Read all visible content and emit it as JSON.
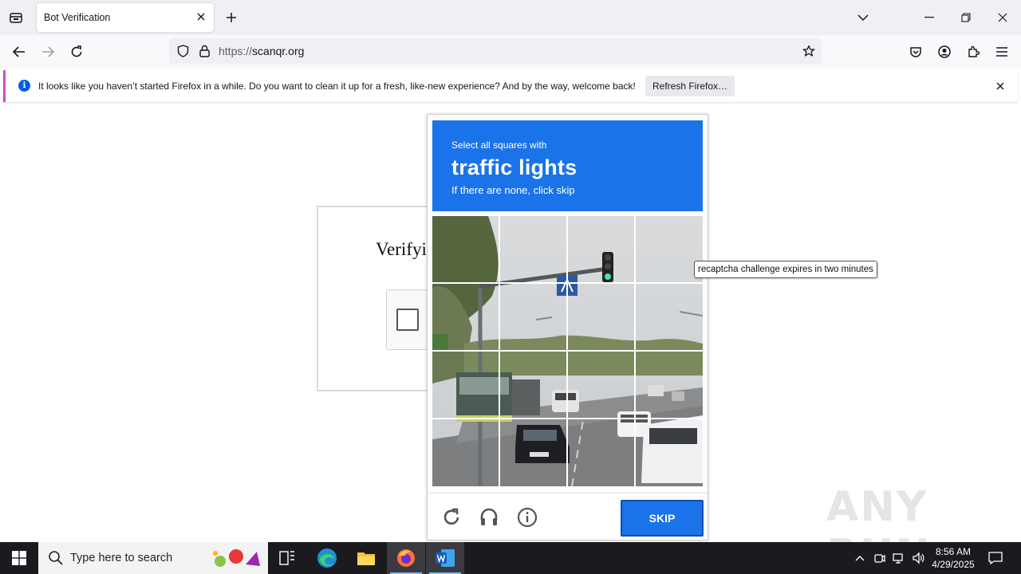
{
  "browser": {
    "tab_title": "Bot Verification",
    "url_protocol": "https://",
    "url_host": "scanqr.org",
    "notification": {
      "text": "It looks like you haven’t started Firefox in a while. Do you want to clean it up for a fresh, like-new experience? And by the way, welcome back!",
      "button": "Refresh Firefox…"
    }
  },
  "page": {
    "title": "Verifyi"
  },
  "captcha": {
    "instruction_line1": "Select all squares with",
    "target": "traffic lights",
    "instruction_line3": "If there are none, click skip",
    "skip_label": "SKIP",
    "tooltip": "recaptcha challenge expires in two minutes",
    "accent_color": "#1a73e8"
  },
  "watermark": "ANY RUN",
  "taskbar": {
    "search_placeholder": "Type here to search",
    "time": "8:56 AM",
    "date": "4/29/2025"
  }
}
